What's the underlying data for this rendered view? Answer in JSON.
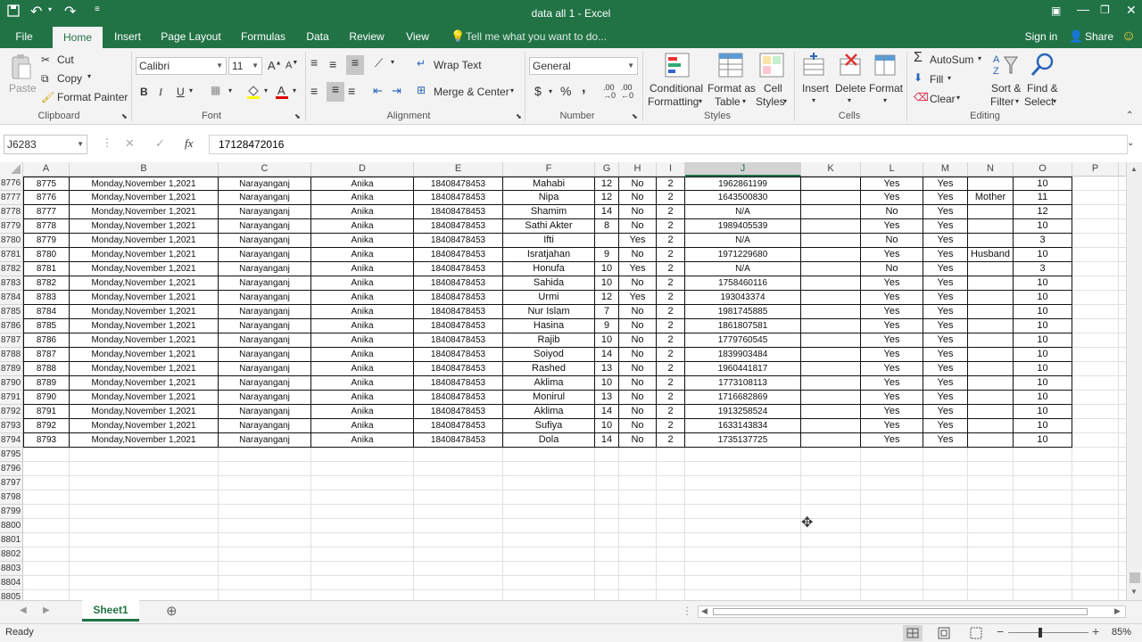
{
  "window": {
    "title": "data all 1 - Excel"
  },
  "tabs": [
    "File",
    "Home",
    "Insert",
    "Page Layout",
    "Formulas",
    "Data",
    "Review",
    "View"
  ],
  "tell_me": "Tell me what you want to do...",
  "account": {
    "signin": "Sign in",
    "share": "Share"
  },
  "ribbon": {
    "clipboard": {
      "paste": "Paste",
      "cut": "Cut",
      "copy": "Copy",
      "format_painter": "Format Painter",
      "label": "Clipboard"
    },
    "font": {
      "name": "Calibri",
      "size": "11",
      "label": "Font",
      "bold": "B",
      "italic": "I",
      "underline": "U"
    },
    "alignment": {
      "wrap": "Wrap Text",
      "merge": "Merge & Center",
      "label": "Alignment"
    },
    "number": {
      "format": "General",
      "currency": "$",
      "percent": "%",
      "comma": ",",
      "label": "Number"
    },
    "styles": {
      "conditional": "Conditional",
      "conditional2": "Formatting",
      "format_as": "Format as",
      "format_as2": "Table",
      "cell_styles": "Cell",
      "cell_styles2": "Styles",
      "label": "Styles"
    },
    "cells": {
      "insert": "Insert",
      "delete": "Delete",
      "format": "Format",
      "label": "Cells"
    },
    "editing": {
      "autosum": "AutoSum",
      "fill": "Fill",
      "clear": "Clear",
      "sort": "Sort &",
      "sort2": "Filter",
      "find": "Find &",
      "find2": "Select",
      "label": "Editing"
    }
  },
  "formula_bar": {
    "name_box": "J6283",
    "fx": "fx",
    "value": "17128472016"
  },
  "columns": [
    "A",
    "B",
    "C",
    "D",
    "E",
    "F",
    "G",
    "H",
    "I",
    "J",
    "K",
    "L",
    "M",
    "N",
    "O",
    "P"
  ],
  "rows": [
    {
      "num": "8776",
      "cells": [
        "8775",
        "Monday,November 1,2021",
        "Narayanganj",
        "Anika",
        "18408478453",
        "Mahabi",
        "12",
        "No",
        "2",
        "1962861199",
        "",
        "Yes",
        "Yes",
        "",
        "10"
      ]
    },
    {
      "num": "8777",
      "cells": [
        "8776",
        "Monday,November 1,2021",
        "Narayanganj",
        "Anika",
        "18408478453",
        "Nipa",
        "12",
        "No",
        "2",
        "1643500830",
        "",
        "Yes",
        "Yes",
        "Mother",
        "11"
      ]
    },
    {
      "num": "8778",
      "cells": [
        "8777",
        "Monday,November 1,2021",
        "Narayanganj",
        "Anika",
        "18408478453",
        "Shamim",
        "14",
        "No",
        "2",
        "N/A",
        "",
        "No",
        "Yes",
        "",
        "12"
      ]
    },
    {
      "num": "8779",
      "cells": [
        "8778",
        "Monday,November 1,2021",
        "Narayanganj",
        "Anika",
        "18408478453",
        "Sathi Akter",
        "8",
        "No",
        "2",
        "1989405539",
        "",
        "Yes",
        "Yes",
        "",
        "10"
      ]
    },
    {
      "num": "8780",
      "cells": [
        "8779",
        "Monday,November 1,2021",
        "Narayanganj",
        "Anika",
        "18408478453",
        "Ifti",
        "",
        "Yes",
        "2",
        "N/A",
        "",
        "No",
        "Yes",
        "",
        "3"
      ]
    },
    {
      "num": "8781",
      "cells": [
        "8780",
        "Monday,November 1,2021",
        "Narayanganj",
        "Anika",
        "18408478453",
        "Isratjahan",
        "9",
        "No",
        "2",
        "1971229680",
        "",
        "Yes",
        "Yes",
        "Husband",
        "10"
      ]
    },
    {
      "num": "8782",
      "cells": [
        "8781",
        "Monday,November 1,2021",
        "Narayanganj",
        "Anika",
        "18408478453",
        "Honufa",
        "10",
        "Yes",
        "2",
        "N/A",
        "",
        "No",
        "Yes",
        "",
        "3"
      ]
    },
    {
      "num": "8783",
      "cells": [
        "8782",
        "Monday,November 1,2021",
        "Narayanganj",
        "Anika",
        "18408478453",
        "Sahida",
        "10",
        "No",
        "2",
        "1758460116",
        "",
        "Yes",
        "Yes",
        "",
        "10"
      ]
    },
    {
      "num": "8784",
      "cells": [
        "8783",
        "Monday,November 1,2021",
        "Narayanganj",
        "Anika",
        "18408478453",
        "Urmi",
        "12",
        "Yes",
        "2",
        "193043374",
        "",
        "Yes",
        "Yes",
        "",
        "10"
      ]
    },
    {
      "num": "8785",
      "cells": [
        "8784",
        "Monday,November 1,2021",
        "Narayanganj",
        "Anika",
        "18408478453",
        "Nur Islam",
        "7",
        "No",
        "2",
        "1981745885",
        "",
        "Yes",
        "Yes",
        "",
        "10"
      ]
    },
    {
      "num": "8786",
      "cells": [
        "8785",
        "Monday,November 1,2021",
        "Narayanganj",
        "Anika",
        "18408478453",
        "Hasina",
        "9",
        "No",
        "2",
        "1861807581",
        "",
        "Yes",
        "Yes",
        "",
        "10"
      ]
    },
    {
      "num": "8787",
      "cells": [
        "8786",
        "Monday,November 1,2021",
        "Narayanganj",
        "Anika",
        "18408478453",
        "Rajib",
        "10",
        "No",
        "2",
        "1779760545",
        "",
        "Yes",
        "Yes",
        "",
        "10"
      ]
    },
    {
      "num": "8788",
      "cells": [
        "8787",
        "Monday,November 1,2021",
        "Narayanganj",
        "Anika",
        "18408478453",
        "Soiyod",
        "14",
        "No",
        "2",
        "1839903484",
        "",
        "Yes",
        "Yes",
        "",
        "10"
      ]
    },
    {
      "num": "8789",
      "cells": [
        "8788",
        "Monday,November 1,2021",
        "Narayanganj",
        "Anika",
        "18408478453",
        "Rashed",
        "13",
        "No",
        "2",
        "1960441817",
        "",
        "Yes",
        "Yes",
        "",
        "10"
      ]
    },
    {
      "num": "8790",
      "cells": [
        "8789",
        "Monday,November 1,2021",
        "Narayanganj",
        "Anika",
        "18408478453",
        "Aklima",
        "10",
        "No",
        "2",
        "1773108113",
        "",
        "Yes",
        "Yes",
        "",
        "10"
      ]
    },
    {
      "num": "8791",
      "cells": [
        "8790",
        "Monday,November 1,2021",
        "Narayanganj",
        "Anika",
        "18408478453",
        "Monirul",
        "13",
        "No",
        "2",
        "1716682869",
        "",
        "Yes",
        "Yes",
        "",
        "10"
      ]
    },
    {
      "num": "8792",
      "cells": [
        "8791",
        "Monday,November 1,2021",
        "Narayanganj",
        "Anika",
        "18408478453",
        "Aklima",
        "14",
        "No",
        "2",
        "1913258524",
        "",
        "Yes",
        "Yes",
        "",
        "10"
      ]
    },
    {
      "num": "8793",
      "cells": [
        "8792",
        "Monday,November 1,2021",
        "Narayanganj",
        "Anika",
        "18408478453",
        "Sufiya",
        "10",
        "No",
        "2",
        "1633143834",
        "",
        "Yes",
        "Yes",
        "",
        "10"
      ]
    },
    {
      "num": "8794",
      "cells": [
        "8793",
        "Monday,November 1,2021",
        "Narayanganj",
        "Anika",
        "18408478453",
        "Dola",
        "14",
        "No",
        "2",
        "1735137725",
        "",
        "Yes",
        "Yes",
        "",
        "10"
      ]
    }
  ],
  "empty_rows": [
    "8795",
    "8796",
    "8797",
    "8798",
    "8799",
    "8800",
    "8801",
    "8802",
    "8803",
    "8804",
    "8805"
  ],
  "sheet": {
    "name": "Sheet1"
  },
  "status": {
    "ready": "Ready",
    "zoom": "85%"
  },
  "colors": {
    "brand": "#217346",
    "ribbon_bg": "#f3f3f3"
  }
}
